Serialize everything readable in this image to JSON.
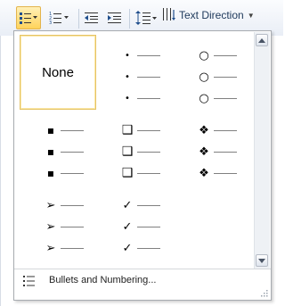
{
  "ribbon": {
    "text_direction_label": "Text Direction",
    "bullets_icon": "bullets-list-icon",
    "numbering_icon": "numbered-list-icon",
    "decrease_indent_icon": "decrease-indent-icon",
    "increase_indent_icon": "increase-indent-icon",
    "line_spacing_icon": "line-spacing-icon",
    "text_direction_icon": "text-direction-icon"
  },
  "gallery": {
    "none_label": "None",
    "styles": [
      {
        "name": "none"
      },
      {
        "name": "small-dot",
        "symbol": "•"
      },
      {
        "name": "hollow-circle",
        "symbol": "○"
      },
      {
        "name": "filled-square",
        "symbol": "▪"
      },
      {
        "name": "hollow-square",
        "symbol": "❑"
      },
      {
        "name": "four-diamond",
        "symbol": "❖"
      },
      {
        "name": "arrowhead",
        "symbol": "➢"
      },
      {
        "name": "checkmark",
        "symbol": "✓"
      }
    ]
  },
  "footer": {
    "label": "Bullets and Numbering...",
    "icon": "bullets-list-icon"
  },
  "colors": {
    "selection_border": "#e5c365",
    "ribbon_button_active": "#ffd35a",
    "label_text": "#1e395b"
  }
}
